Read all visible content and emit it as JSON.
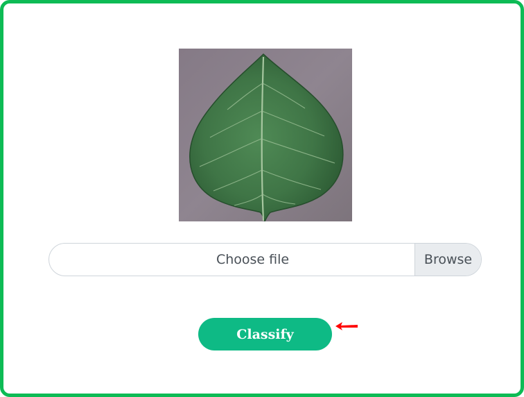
{
  "file_input": {
    "label": "Choose file",
    "browse_label": "Browse"
  },
  "classify_button": {
    "label": "Classify"
  },
  "colors": {
    "frame_border": "#0dbb55",
    "classify_button": "#0eba85",
    "pointer_arrow": "#ff0000"
  },
  "icons": {
    "pointer": "arrow-left-icon"
  }
}
